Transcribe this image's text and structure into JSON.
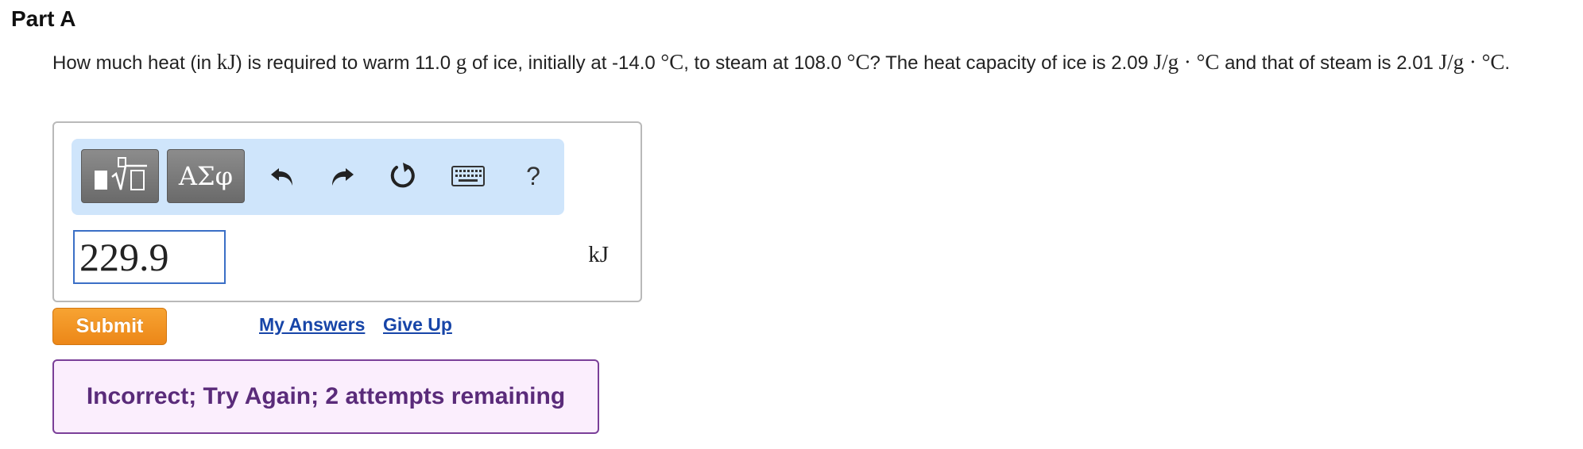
{
  "part": {
    "title": "Part A"
  },
  "question": {
    "segments": {
      "s1": "How much heat (in ",
      "m1": "kJ",
      "s2": ") is required to warm 11.0 ",
      "m2": "g",
      "s3": " of ice, initially at -14.0 ",
      "m3": "°C",
      "s4": ", to steam at 108.0 ",
      "m4": "°C",
      "s5": "? The heat capacity of ice is 2.09 ",
      "m5": "J/g · °C",
      "s6": " and that of steam is 2.01 ",
      "m6": "J/g · °C",
      "s7": "."
    }
  },
  "toolbar": {
    "templates_icon": "templates-icon",
    "symbols_label": "ΑΣφ",
    "undo_icon": "undo-icon",
    "redo_icon": "redo-icon",
    "reset_icon": "reset-icon",
    "keyboard_icon": "keyboard-icon",
    "help_label": "?"
  },
  "answer": {
    "value": "229.9",
    "unit": "kJ"
  },
  "actions": {
    "submit_label": "Submit",
    "my_answers_label": "My Answers",
    "give_up_label": "Give Up"
  },
  "feedback": {
    "message": "Incorrect; Try Again; 2 attempts remaining"
  },
  "colors": {
    "toolbar_bg": "#cfe5fb",
    "submit_bg": "#ec8718",
    "link": "#1745a8",
    "feedback_border": "#7a3f98",
    "feedback_bg": "#fbeefd",
    "input_border": "#3b6fc6"
  }
}
